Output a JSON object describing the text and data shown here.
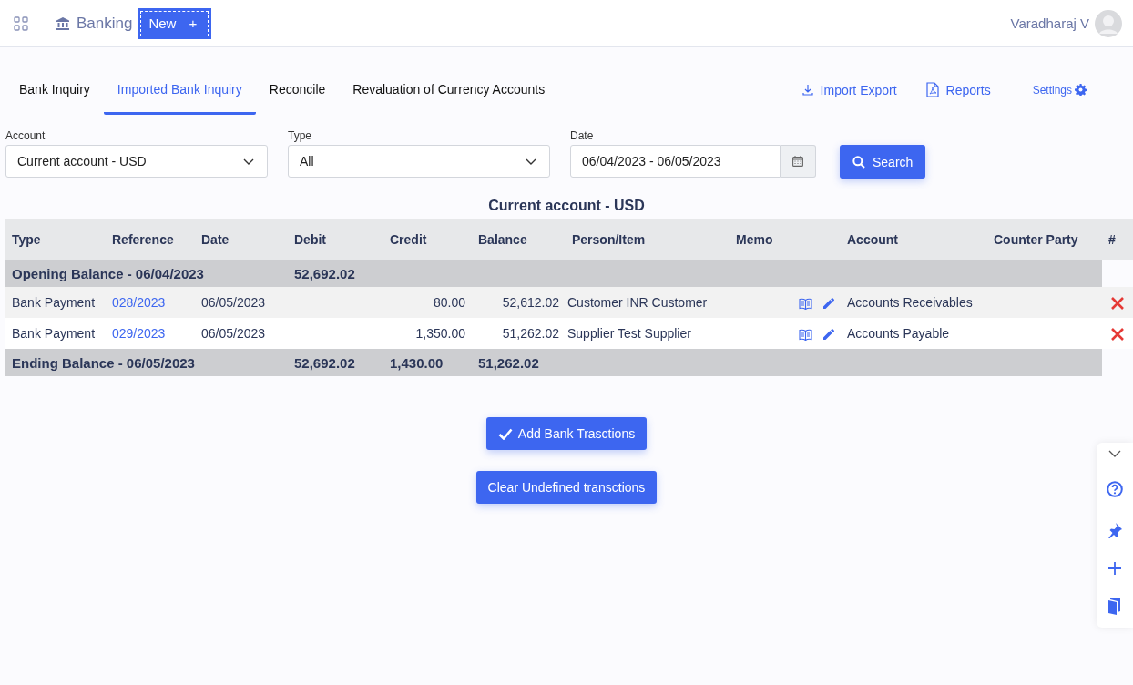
{
  "header": {
    "module": "Banking",
    "new_button": "New",
    "new_icon": "+",
    "user_name": "Varadharaj V"
  },
  "tabs": [
    {
      "label": "Bank Inquiry",
      "selected": false
    },
    {
      "label": "Imported Bank Inquiry",
      "selected": true
    },
    {
      "label": "Reconcile",
      "selected": false
    },
    {
      "label": "Revaluation of Currency Accounts",
      "selected": false
    }
  ],
  "actions": [
    {
      "kind": "download",
      "label": "Import Export"
    },
    {
      "kind": "pdf",
      "label": "Reports"
    },
    {
      "kind": "settings",
      "label": "Settings"
    }
  ],
  "filters": {
    "account": {
      "label": "Account",
      "value": "Current account - USD"
    },
    "type": {
      "label": "Type",
      "value": "All"
    },
    "date": {
      "label": "Date",
      "value": "06/04/2023 - 06/05/2023"
    },
    "search_button": "Search"
  },
  "table": {
    "title": "Current account - USD",
    "columns": [
      "Type",
      "Reference",
      "Date",
      "Debit",
      "Credit",
      "Balance",
      "Person/Item",
      "Memo",
      "Account",
      "Counter Party",
      "#"
    ],
    "rows": [
      {
        "kind": "balance",
        "label": "Opening Balance - 06/04/2023",
        "debit": "52,692.02",
        "credit": "",
        "balance": ""
      },
      {
        "kind": "entry",
        "type": "Bank Payment",
        "reference": "028/2023",
        "date": "06/05/2023",
        "debit": "",
        "credit": "80.00",
        "balance": "52,612.02",
        "person": "Customer INR Customer",
        "account": "Accounts Receivables"
      },
      {
        "kind": "entry",
        "type": "Bank Payment",
        "reference": "029/2023",
        "date": "06/05/2023",
        "debit": "",
        "credit": "1,350.00",
        "balance": "51,262.02",
        "person": "Supplier Test Supplier",
        "account": "Accounts Payable"
      },
      {
        "kind": "balance",
        "label": "Ending Balance - 06/05/2023",
        "debit": "52,692.02",
        "credit": "1,430.00",
        "balance": "51,262.02"
      }
    ]
  },
  "buttons": [
    {
      "kind": "check",
      "label": "Add Bank Trasctions"
    },
    {
      "kind": "plain",
      "label": "Clear Undefined transctions"
    }
  ]
}
